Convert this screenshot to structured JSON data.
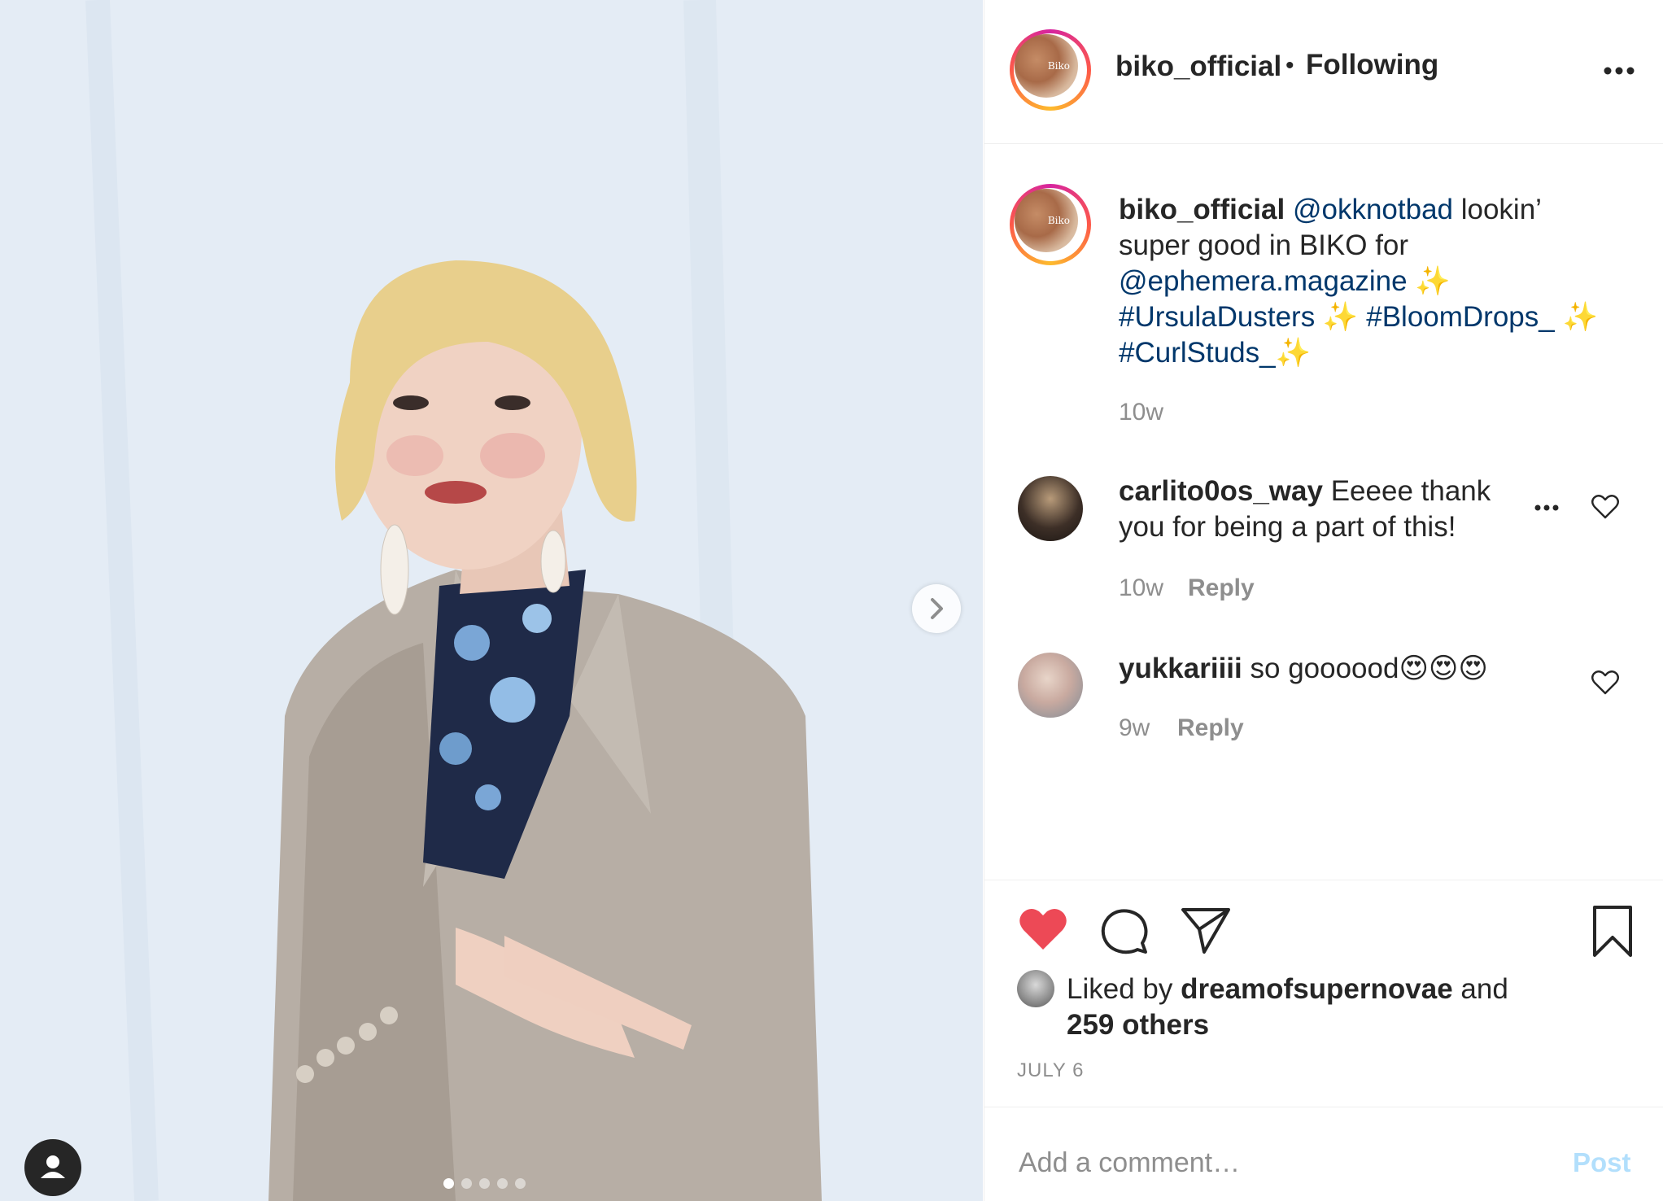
{
  "header": {
    "username": "biko_official",
    "separator": "•",
    "follow_status": "Following",
    "avatar_text": "Biko"
  },
  "caption": {
    "username": "biko_official",
    "parts": [
      {
        "text": "@okknotbad",
        "type": "mention"
      },
      {
        "text": " lookin’ super good in BIKO for ",
        "type": "text"
      },
      {
        "text": "@ephemera.magazine",
        "type": "mention"
      },
      {
        "text": " ✨ ",
        "type": "text"
      },
      {
        "text": "#UrsulaDusters",
        "type": "hashtag"
      },
      {
        "text": " ✨ ",
        "type": "text"
      },
      {
        "text": "#BloomDrops_",
        "type": "hashtag"
      },
      {
        "text": " ✨ ",
        "type": "text"
      },
      {
        "text": "#CurlStuds_",
        "type": "hashtag"
      },
      {
        "text": "✨",
        "type": "text"
      }
    ],
    "age": "10w"
  },
  "comments": [
    {
      "username": "carlito0os_way",
      "text": "Eeeee thank you for being a part of this!",
      "age": "10w",
      "reply_label": "Reply"
    },
    {
      "username": "yukkariiii",
      "text": "so goooood😍😍😍",
      "age": "9w",
      "reply_label": "Reply"
    }
  ],
  "likes": {
    "prefix": "Liked by",
    "user": "dreamofsupernovae",
    "conjunction": "and",
    "others": "259 others"
  },
  "post_date": "JULY 6",
  "comment_box": {
    "placeholder": "Add a comment…",
    "post_label": "Post"
  },
  "carousel": {
    "total": 5,
    "active": 0
  },
  "icons": {
    "more": "more-options-icon",
    "like": "heart-icon",
    "comment": "comment-icon",
    "share": "paper-plane-icon",
    "save": "bookmark-icon",
    "next": "chevron-right-icon",
    "user_tag": "user-tag-icon"
  },
  "colors": {
    "like_red": "#ed4956",
    "link_blue": "#00376b",
    "post_disabled": "#b2dffc",
    "meta_gray": "#8e8e8e"
  }
}
